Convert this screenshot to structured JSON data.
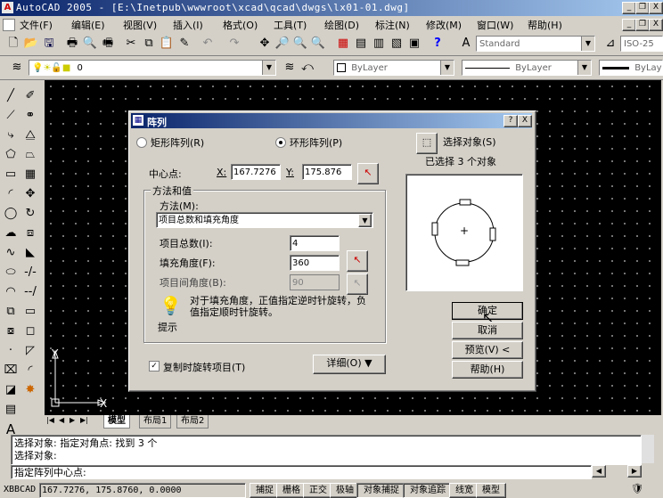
{
  "window": {
    "title": "AutoCAD 2005 - [E:\\Inetpub\\wwwroot\\xcad\\qcad\\dwgs\\lx01-01.dwg]",
    "min": "_",
    "restore": "❐",
    "close": "X"
  },
  "menu": [
    {
      "label": "文件(F)"
    },
    {
      "label": "编辑(E)"
    },
    {
      "label": "视图(V)"
    },
    {
      "label": "插入(I)"
    },
    {
      "label": "格式(O)"
    },
    {
      "label": "工具(T)"
    },
    {
      "label": "绘图(D)"
    },
    {
      "label": "标注(N)"
    },
    {
      "label": "修改(M)"
    },
    {
      "label": "窗口(W)"
    },
    {
      "label": "帮助(H)"
    }
  ],
  "toolbar": {
    "textstyle": "Standard",
    "dimstyle": "ISO-25",
    "layer": "0",
    "color": "ByLayer",
    "linetype": "ByLayer",
    "lineweight": "ByLayer"
  },
  "dialog": {
    "title": "阵列",
    "help": "?",
    "close": "X",
    "rect_array": "矩形阵列(R)",
    "polar_array": "环形阵列(P)",
    "select_objects": "选择对象(S)",
    "selected_count": "已选择 3 个对象",
    "center_label": "中心点:",
    "x_label": "X:",
    "x_value": "167.7276",
    "y_label": "Y:",
    "y_value": "175.876",
    "method_group": "方法和值",
    "method_label": "方法(M):",
    "method_value": "项目总数和填充角度",
    "total_label": "项目总数(I):",
    "total_value": "4",
    "fill_label": "填充角度(F):",
    "fill_value": "360",
    "between_label": "项目间角度(B):",
    "between_value": "90",
    "hint_text": "对于填充角度，正值指定逆时针旋转，负值指定顺时针旋转。",
    "hint_label": "提示",
    "rotate_label": "复制时旋转项目(T)",
    "rotate_checked": true,
    "detail_button": "详细(O) ▼",
    "ok": "确定",
    "cancel": "取消",
    "preview": "预览(V) <",
    "help_button": "帮助(H)",
    "preview_center": "+"
  },
  "tabs": [
    {
      "label": "模型"
    },
    {
      "label": "布局1"
    },
    {
      "label": "布局2"
    }
  ],
  "command": {
    "line1": "选择对象: 指定对角点: 找到 3 个",
    "line2": "选择对象:",
    "prompt": "指定阵列中心点:"
  },
  "status": {
    "app": "XBBCAD",
    "coords": "167.7276, 175.8760, 0.0000",
    "buttons": [
      "捕捉",
      "栅格",
      "正交",
      "极轴",
      "对象捕捉",
      "对象追踪",
      "线宽",
      "模型"
    ]
  },
  "ucs": {
    "x": "X",
    "y": "Y"
  }
}
